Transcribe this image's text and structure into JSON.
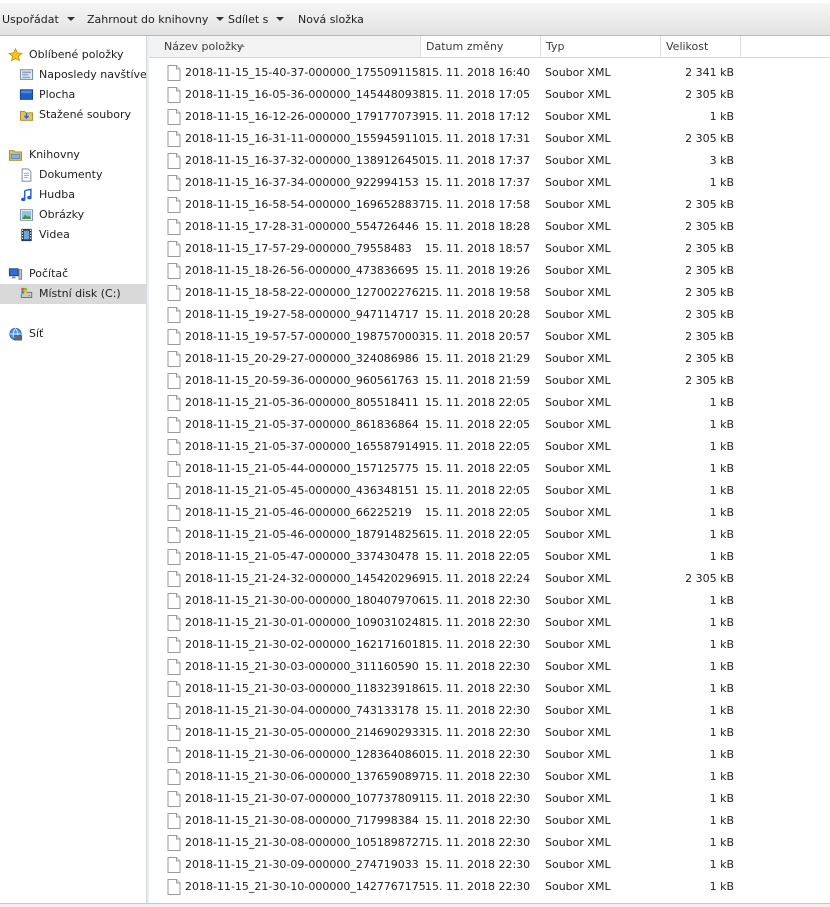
{
  "toolbar": {
    "organize_label": "Uspořádat",
    "include_library_label": "Zahrnout do knihovny",
    "share_label": "Sdílet s",
    "new_folder_label": "Nová složka"
  },
  "sidebar": {
    "favorites": {
      "label": "Oblíbené položky",
      "items": [
        {
          "label": "Naposledy navštívené"
        },
        {
          "label": "Plocha"
        },
        {
          "label": "Stažené soubory"
        }
      ]
    },
    "libraries": {
      "label": "Knihovny",
      "items": [
        {
          "label": "Dokumenty"
        },
        {
          "label": "Hudba"
        },
        {
          "label": "Obrázky"
        },
        {
          "label": "Videa"
        }
      ]
    },
    "computer": {
      "label": "Počítač",
      "items": [
        {
          "label": "Místní disk (C:)",
          "selected": true
        }
      ]
    },
    "network": {
      "label": "Síť"
    }
  },
  "columns": {
    "name": "Název položky",
    "date": "Datum změny",
    "type": "Typ",
    "size": "Velikost"
  },
  "files": [
    {
      "name": "2018-11-15_15-40-37-000000_1755091158",
      "date": "15. 11. 2018 16:40",
      "type": "Soubor XML",
      "size": "2 341 kB"
    },
    {
      "name": "2018-11-15_16-05-36-000000_1454480938",
      "date": "15. 11. 2018 17:05",
      "type": "Soubor XML",
      "size": "2 305 kB"
    },
    {
      "name": "2018-11-15_16-12-26-000000_1791770739",
      "date": "15. 11. 2018 17:12",
      "type": "Soubor XML",
      "size": "1 kB"
    },
    {
      "name": "2018-11-15_16-31-11-000000_1559459110",
      "date": "15. 11. 2018 17:31",
      "type": "Soubor XML",
      "size": "2 305 kB"
    },
    {
      "name": "2018-11-15_16-37-32-000000_1389126450",
      "date": "15. 11. 2018 17:37",
      "type": "Soubor XML",
      "size": "3 kB"
    },
    {
      "name": "2018-11-15_16-37-34-000000_922994153",
      "date": "15. 11. 2018 17:37",
      "type": "Soubor XML",
      "size": "1 kB"
    },
    {
      "name": "2018-11-15_16-58-54-000000_1696528837",
      "date": "15. 11. 2018 17:58",
      "type": "Soubor XML",
      "size": "2 305 kB"
    },
    {
      "name": "2018-11-15_17-28-31-000000_554726446",
      "date": "15. 11. 2018 18:28",
      "type": "Soubor XML",
      "size": "2 305 kB"
    },
    {
      "name": "2018-11-15_17-57-29-000000_79558483",
      "date": "15. 11. 2018 18:57",
      "type": "Soubor XML",
      "size": "2 305 kB"
    },
    {
      "name": "2018-11-15_18-26-56-000000_473836695",
      "date": "15. 11. 2018 19:26",
      "type": "Soubor XML",
      "size": "2 305 kB"
    },
    {
      "name": "2018-11-15_18-58-22-000000_1270022762",
      "date": "15. 11. 2018 19:58",
      "type": "Soubor XML",
      "size": "2 305 kB"
    },
    {
      "name": "2018-11-15_19-27-58-000000_947114717",
      "date": "15. 11. 2018 20:28",
      "type": "Soubor XML",
      "size": "2 305 kB"
    },
    {
      "name": "2018-11-15_19-57-57-000000_1987570003",
      "date": "15. 11. 2018 20:57",
      "type": "Soubor XML",
      "size": "2 305 kB"
    },
    {
      "name": "2018-11-15_20-29-27-000000_324086986",
      "date": "15. 11. 2018 21:29",
      "type": "Soubor XML",
      "size": "2 305 kB"
    },
    {
      "name": "2018-11-15_20-59-36-000000_960561763",
      "date": "15. 11. 2018 21:59",
      "type": "Soubor XML",
      "size": "2 305 kB"
    },
    {
      "name": "2018-11-15_21-05-36-000000_805518411",
      "date": "15. 11. 2018 22:05",
      "type": "Soubor XML",
      "size": "1 kB"
    },
    {
      "name": "2018-11-15_21-05-37-000000_861836864",
      "date": "15. 11. 2018 22:05",
      "type": "Soubor XML",
      "size": "1 kB"
    },
    {
      "name": "2018-11-15_21-05-37-000000_1655879149",
      "date": "15. 11. 2018 22:05",
      "type": "Soubor XML",
      "size": "1 kB"
    },
    {
      "name": "2018-11-15_21-05-44-000000_157125775",
      "date": "15. 11. 2018 22:05",
      "type": "Soubor XML",
      "size": "1 kB"
    },
    {
      "name": "2018-11-15_21-05-45-000000_436348151",
      "date": "15. 11. 2018 22:05",
      "type": "Soubor XML",
      "size": "1 kB"
    },
    {
      "name": "2018-11-15_21-05-46-000000_66225219",
      "date": "15. 11. 2018 22:05",
      "type": "Soubor XML",
      "size": "1 kB"
    },
    {
      "name": "2018-11-15_21-05-46-000000_1879148256",
      "date": "15. 11. 2018 22:05",
      "type": "Soubor XML",
      "size": "1 kB"
    },
    {
      "name": "2018-11-15_21-05-47-000000_337430478",
      "date": "15. 11. 2018 22:05",
      "type": "Soubor XML",
      "size": "1 kB"
    },
    {
      "name": "2018-11-15_21-24-32-000000_1454202969",
      "date": "15. 11. 2018 22:24",
      "type": "Soubor XML",
      "size": "2 305 kB"
    },
    {
      "name": "2018-11-15_21-30-00-000000_1804079706",
      "date": "15. 11. 2018 22:30",
      "type": "Soubor XML",
      "size": "1 kB"
    },
    {
      "name": "2018-11-15_21-30-01-000000_1090310248",
      "date": "15. 11. 2018 22:30",
      "type": "Soubor XML",
      "size": "1 kB"
    },
    {
      "name": "2018-11-15_21-30-02-000000_1621716018",
      "date": "15. 11. 2018 22:30",
      "type": "Soubor XML",
      "size": "1 kB"
    },
    {
      "name": "2018-11-15_21-30-03-000000_311160590",
      "date": "15. 11. 2018 22:30",
      "type": "Soubor XML",
      "size": "1 kB"
    },
    {
      "name": "2018-11-15_21-30-03-000000_1183239186",
      "date": "15. 11. 2018 22:30",
      "type": "Soubor XML",
      "size": "1 kB"
    },
    {
      "name": "2018-11-15_21-30-04-000000_743133178",
      "date": "15. 11. 2018 22:30",
      "type": "Soubor XML",
      "size": "1 kB"
    },
    {
      "name": "2018-11-15_21-30-05-000000_2146902933",
      "date": "15. 11. 2018 22:30",
      "type": "Soubor XML",
      "size": "1 kB"
    },
    {
      "name": "2018-11-15_21-30-06-000000_1283640860",
      "date": "15. 11. 2018 22:30",
      "type": "Soubor XML",
      "size": "1 kB"
    },
    {
      "name": "2018-11-15_21-30-06-000000_1376590897",
      "date": "15. 11. 2018 22:30",
      "type": "Soubor XML",
      "size": "1 kB"
    },
    {
      "name": "2018-11-15_21-30-07-000000_1077378091",
      "date": "15. 11. 2018 22:30",
      "type": "Soubor XML",
      "size": "1 kB"
    },
    {
      "name": "2018-11-15_21-30-08-000000_717998384",
      "date": "15. 11. 2018 22:30",
      "type": "Soubor XML",
      "size": "1 kB"
    },
    {
      "name": "2018-11-15_21-30-08-000000_1051898727",
      "date": "15. 11. 2018 22:30",
      "type": "Soubor XML",
      "size": "1 kB"
    },
    {
      "name": "2018-11-15_21-30-09-000000_274719033",
      "date": "15. 11. 2018 22:30",
      "type": "Soubor XML",
      "size": "1 kB"
    },
    {
      "name": "2018-11-15_21-30-10-000000_1427767175",
      "date": "15. 11. 2018 22:30",
      "type": "Soubor XML",
      "size": "1 kB"
    }
  ],
  "icons": {
    "file": "xml-file-icon",
    "favorites": "star-icon",
    "recent": "recent-places-icon",
    "desktop": "desktop-icon",
    "downloads": "downloads-folder-icon",
    "libraries": "libraries-icon",
    "documents": "documents-icon",
    "music": "music-icon",
    "pictures": "pictures-icon",
    "videos": "videos-icon",
    "computer": "computer-icon",
    "local_disk": "hard-drive-icon",
    "network": "network-icon"
  },
  "colors": {
    "selected_bg": "#d9d9d9",
    "toolbar_top": "#f6f6f6",
    "toolbar_bottom": "#e2e2e2",
    "text": "#1e1e1e"
  }
}
